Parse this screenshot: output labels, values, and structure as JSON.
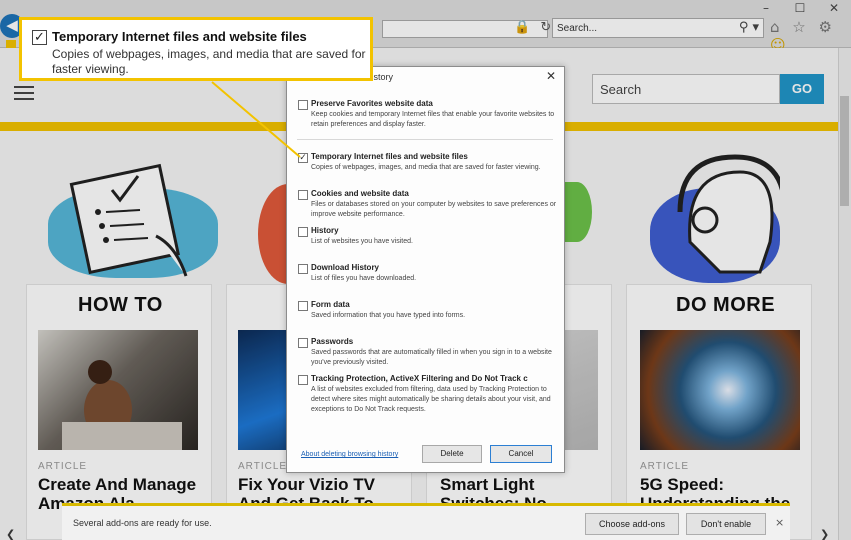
{
  "browser": {
    "address_icons": "🔒 ↻",
    "search_placeholder": "Search...",
    "search_icons": "⚲ ▾",
    "toolbar_icons": "⌂ ☆ ⚙",
    "smiley": "☺",
    "window_controls": [
      "–",
      "☐",
      "✕"
    ]
  },
  "site": {
    "search_placeholder": "Search",
    "go_label": "GO",
    "sections": [
      {
        "label": "HOW TO",
        "tag": "ARTICLE",
        "title": "Create And Manage Amazon Ala"
      },
      {
        "label": "",
        "tag": "ARTICLE",
        "title": "Fix Your Vizio TV And Get Back To"
      },
      {
        "label": "",
        "tag": "",
        "title": "Smart Light Switches: No"
      },
      {
        "label": "DO MORE",
        "tag": "ARTICLE",
        "title": "5G Speed: Understanding the"
      }
    ]
  },
  "dialog": {
    "title": "History",
    "options": [
      {
        "title": "Preserve Favorites website data",
        "desc": "Keep cookies and temporary Internet files that enable your favorite websites to retain preferences and display faster.",
        "checked": false
      },
      {
        "title": "Temporary Internet files and website files",
        "desc": "Copies of webpages, images, and media that are saved for faster viewing.",
        "checked": true
      },
      {
        "title": "Cookies and website data",
        "desc": "Files or databases stored on your computer by websites to save preferences or improve website performance.",
        "checked": false
      },
      {
        "title": "History",
        "desc": "List of websites you have visited.",
        "checked": false
      },
      {
        "title": "Download History",
        "desc": "List of files you have downloaded.",
        "checked": false
      },
      {
        "title": "Form data",
        "desc": "Saved information that you have typed into forms.",
        "checked": false
      },
      {
        "title": "Passwords",
        "desc": "Saved passwords that are automatically filled in when you sign in to a website you've previously visited.",
        "checked": false
      },
      {
        "title": "Tracking Protection, ActiveX Filtering and Do Not Track c",
        "desc": "A list of websites excluded from filtering, data used by Tracking Protection to detect where sites might automatically be sharing details about your visit, and exceptions to Do Not Track requests.",
        "checked": false
      }
    ],
    "link": "About deleting browsing history",
    "delete_label": "Delete",
    "cancel_label": "Cancel"
  },
  "callout": {
    "title": "Temporary Internet files and website files",
    "desc": "Copies of webpages, images, and media that are saved for faster viewing."
  },
  "notification": {
    "message": "Several add-ons are ready for use.",
    "choose_label": "Choose add-ons",
    "dont_label": "Don't enable",
    "close": "×"
  },
  "colors": {
    "accent_yellow": "#f3c300",
    "go_blue": "#2196c9",
    "link_blue": "#1a5fb4"
  }
}
